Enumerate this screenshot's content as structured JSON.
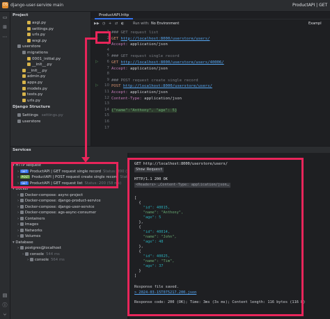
{
  "titlebar": {
    "project_badge": "DS",
    "project_name": "django-user-service",
    "branch": "main",
    "run_config": "ProductAPI | GET"
  },
  "project_panel": {
    "title": "Project",
    "items": [
      {
        "label": "asgi.py",
        "type": "py",
        "indent": 3
      },
      {
        "label": "settings.py",
        "type": "py",
        "indent": 3
      },
      {
        "label": "urls.py",
        "type": "py",
        "indent": 3
      },
      {
        "label": "wsgi.py",
        "type": "py",
        "indent": 3
      },
      {
        "label": "userstore",
        "type": "folder",
        "indent": 1
      },
      {
        "label": "migrations",
        "type": "folder",
        "indent": 2
      },
      {
        "label": "0001_initial.py",
        "type": "py",
        "indent": 3
      },
      {
        "label": "__init__.py",
        "type": "py",
        "indent": 3
      },
      {
        "label": "__init__.py",
        "type": "py",
        "indent": 2
      },
      {
        "label": "admin.py",
        "type": "py",
        "indent": 2
      },
      {
        "label": "apps.py",
        "type": "py",
        "indent": 2
      },
      {
        "label": "models.py",
        "type": "py",
        "indent": 2
      },
      {
        "label": "tests.py",
        "type": "py",
        "indent": 2
      },
      {
        "label": "urls.py",
        "type": "py",
        "indent": 2
      }
    ],
    "django_structure_title": "Django Structure",
    "django_items": [
      {
        "label": "Settings",
        "extra": "settings.py"
      },
      {
        "label": "userstore",
        "extra": ""
      }
    ]
  },
  "editor": {
    "tab_label": "ProductAPI.http",
    "toolbar": {
      "run_with": "Run with:",
      "env": "No Environment",
      "examples": "Exampl"
    },
    "line_numbers": [
      "1",
      "2",
      "3",
      "4",
      "5",
      "6",
      "7",
      "8",
      "9",
      "10",
      "11",
      "12",
      "13",
      "14",
      "15",
      "16",
      "17"
    ],
    "lines": [
      {
        "cls": "c-com",
        "text": "### GET request list"
      },
      {
        "kw": "GET",
        "url": "http://localhost:8000/userstore/users/"
      },
      {
        "hdr": "Accept:",
        "val": " application/json"
      },
      {
        "text": ""
      },
      {
        "cls": "c-com",
        "text": "### GET request single record"
      },
      {
        "kw": "GET",
        "url": "http://localhost:8000/userstore/users/40006/"
      },
      {
        "hdr": "Accept:",
        "val": " application/json"
      },
      {
        "text": ""
      },
      {
        "cls": "c-com",
        "text": "### POST request create single record"
      },
      {
        "kw": "POST",
        "url": "http://localhost:8000/userstore/users/"
      },
      {
        "hdr": "Accept:",
        "val": " application/json"
      },
      {
        "hdr": "Content-Type:",
        "val": " application/json"
      },
      {
        "text": ""
      },
      {
        "json": "{\"name\":\"Anthony\", \"age\": 5}"
      }
    ]
  },
  "services": {
    "title": "Services",
    "items": [
      {
        "label": "HTTP Request",
        "indent": 1,
        "kind": "group"
      },
      {
        "label": "ProductAPI | GET request single record",
        "badge": "GET",
        "status": "Status: 200 (57ms)",
        "indent": 2
      },
      {
        "label": "ProductAPI | POST request create single record",
        "badge": "POST",
        "status": "Status: 201 (5 ms)",
        "indent": 2
      },
      {
        "label": "ProductAPI | GET request list",
        "badge": "GET",
        "status": "Status: 200 (58 ms)",
        "indent": 2
      },
      {
        "label": "Docker",
        "indent": 1,
        "kind": "group"
      },
      {
        "label": "Docker-compose: async-project",
        "indent": 2
      },
      {
        "label": "Docker-compose: django-product-service",
        "indent": 2
      },
      {
        "label": "Docker-compose: django-user-service",
        "indent": 2
      },
      {
        "label": "Docker-compose: ags-async-consumer",
        "indent": 2
      },
      {
        "label": "Containers",
        "indent": 2
      },
      {
        "label": "Images",
        "indent": 2
      },
      {
        "label": "Networks",
        "indent": 2
      },
      {
        "label": "Volumes",
        "indent": 2
      },
      {
        "label": "Database",
        "indent": 1,
        "kind": "group"
      },
      {
        "label": "postgres@localhost",
        "indent": 2
      },
      {
        "label": "console",
        "status": "544 ms",
        "indent": 3
      },
      {
        "label": "console",
        "status": "564 ms",
        "indent": 4
      }
    ]
  },
  "response": {
    "request_line": "GET http://localhost:8000/userstore/users/",
    "show_request": "Show Request",
    "status_line": "HTTP/1.1 200 OK",
    "headers_collapsed": "<Headers> …Content-Type: application/json…",
    "body": [
      "[",
      "  {",
      "    \"id\": 40015,",
      "    \"name\": \"Anthony\",",
      "    \"age\": 5",
      "  },",
      "  {",
      "    \"id\": 40014,",
      "    \"name\": \"John\",",
      "    \"age\": 48",
      "  },",
      "  {",
      "    \"id\": 40025,",
      "    \"name\": \"Tim\",",
      "    \"age\": 37",
      "  }",
      "]"
    ],
    "saved": "Response file saved.",
    "file_link": "> 2024-03-15T075217.200.json",
    "footer": "Response code: 200 (OK); Time: 3ms (3s ms); Content length: 116 bytes (116 B)"
  },
  "colors": {
    "accent": "#3574f0",
    "highlight": "#e8255a"
  }
}
